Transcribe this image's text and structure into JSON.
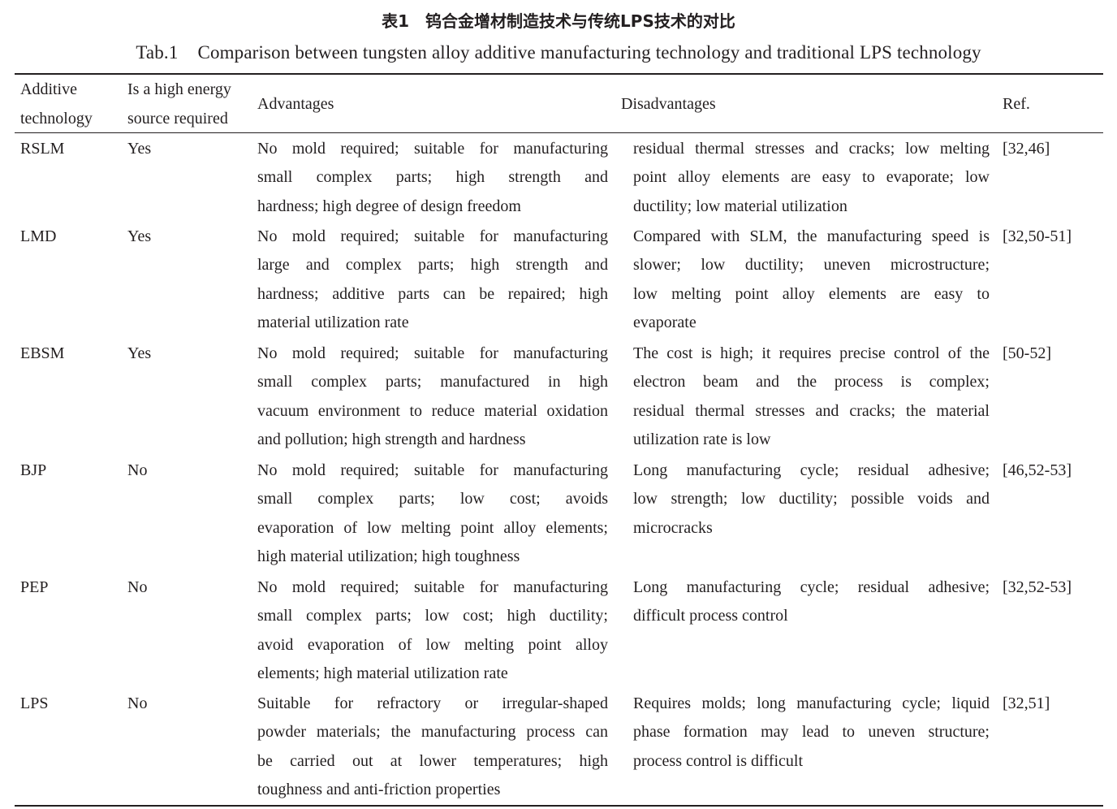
{
  "caption": {
    "cn": "表1　钨合金增材制造技术与传统LPS技术的对比",
    "label": "Tab.1",
    "en": "Comparison between tungsten alloy additive manufacturing technology and traditional LPS technology"
  },
  "headers": {
    "tech": [
      "Additive",
      "technology"
    ],
    "energy": [
      "Is a high energy",
      "source required"
    ],
    "adv": "Advantages",
    "dis": "Disadvantages",
    "ref": "Ref."
  },
  "rows": [
    {
      "tech": "RSLM",
      "energy": "Yes",
      "adv": [
        "No mold required; suitable for manufacturing",
        "small complex parts; high strength and",
        "hardness; high degree of design freedom"
      ],
      "dis": [
        "residual thermal stresses and cracks; low melting",
        "point alloy elements are easy to evaporate; low",
        "ductility; low material utilization"
      ],
      "ref": "[32,46]"
    },
    {
      "tech": "LMD",
      "energy": "Yes",
      "adv": [
        "No mold required; suitable for manufacturing",
        "large and complex parts; high strength and",
        "hardness; additive parts can be repaired; high",
        "material utilization rate"
      ],
      "dis": [
        "Compared with SLM, the manufacturing speed is",
        "slower; low ductility; uneven microstructure;",
        "low melting point alloy elements are easy to",
        "evaporate"
      ],
      "ref": "[32,50-51]"
    },
    {
      "tech": "EBSM",
      "energy": "Yes",
      "adv": [
        "No mold required; suitable for manufacturing",
        "small complex parts; manufactured in high",
        "vacuum environment to reduce material oxidation",
        "and pollution; high strength and hardness"
      ],
      "dis": [
        "The cost is high; it requires precise control of the",
        "electron beam and the process is complex;",
        "residual thermal stresses and cracks; the material",
        "utilization rate is low"
      ],
      "ref": "[50-52]"
    },
    {
      "tech": "BJP",
      "energy": "No",
      "adv": [
        "No mold required; suitable for manufacturing",
        "small complex parts; low cost; avoids",
        "evaporation of low melting point alloy elements;",
        "high material utilization; high toughness"
      ],
      "dis": [
        "Long manufacturing cycle; residual adhesive;",
        "low strength; low ductility; possible voids and",
        "microcracks"
      ],
      "ref": "[46,52-53]"
    },
    {
      "tech": "PEP",
      "energy": "No",
      "adv": [
        "No mold required; suitable for manufacturing",
        "small complex parts; low cost; high ductility;",
        "avoid evaporation of low melting point alloy",
        "elements; high material utilization rate"
      ],
      "dis": [
        "Long manufacturing cycle; residual adhesive;",
        "difficult process control"
      ],
      "ref": "[32,52-53]"
    },
    {
      "tech": "LPS",
      "energy": "No",
      "adv": [
        "Suitable for refractory or irregular-shaped",
        "powder materials; the manufacturing process can",
        "be carried out at lower temperatures; high",
        "toughness and anti-friction properties"
      ],
      "dis": [
        "Requires molds; long manufacturing cycle; liquid",
        "phase formation may lead to uneven structure;",
        "process control is difficult"
      ],
      "ref": "[32,51]"
    }
  ]
}
